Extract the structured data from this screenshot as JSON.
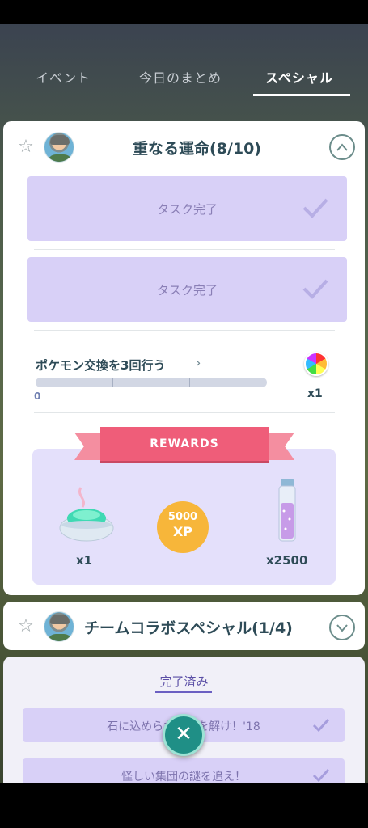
{
  "tabs": [
    {
      "label": "イベント"
    },
    {
      "label": "今日のまとめ"
    },
    {
      "label": "スペシャル"
    }
  ],
  "card1": {
    "title": "重なる運命(8/10)",
    "tasks_done": [
      {
        "label": "タスク完了"
      },
      {
        "label": "タスク完了"
      }
    ],
    "task": {
      "text": "ポケモン交換を3回行う",
      "progress": 0,
      "progress_label": "0",
      "reward_qty": "x1",
      "reward_icon": "rainbow-candy-icon"
    },
    "rewards": {
      "banner": "REWARDS",
      "items": [
        {
          "icon": "incense-icon",
          "qty": "x1"
        },
        {
          "icon": "xp-icon",
          "amount": "5000",
          "unit": "XP"
        },
        {
          "icon": "stardust-icon",
          "qty": "x2500"
        }
      ]
    }
  },
  "card2": {
    "title": "チームコラボスペシャル(1/4)"
  },
  "card3": {
    "tab_label": "完了済み",
    "rows": [
      {
        "label": "石に込められた謎を解け！'18"
      },
      {
        "label": "怪しい集団の謎を追え！"
      }
    ]
  },
  "colors": {
    "accent_purple": "#d8d0f7",
    "ribbon": "#ef5d79",
    "xp": "#f7b63a",
    "fab": "#1f8f86"
  }
}
